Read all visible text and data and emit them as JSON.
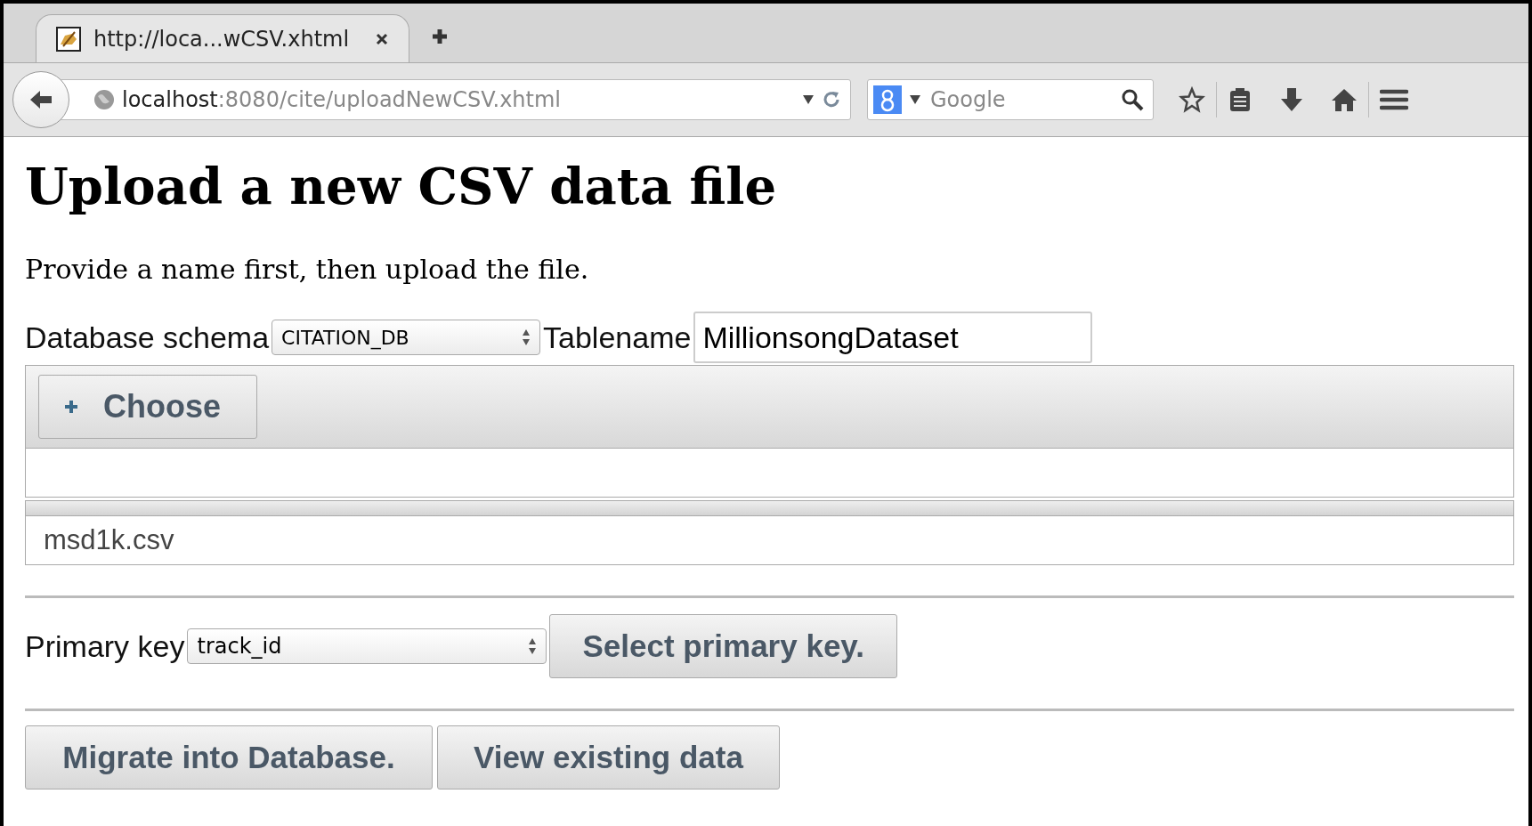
{
  "browser": {
    "tabs": [
      {
        "title": "http://loca...wCSV.xhtml",
        "selected": true
      }
    ],
    "address": {
      "host": "localhost",
      "path": ":8080/cite/uploadNewCSV.xhtml"
    },
    "search": {
      "placeholder": "Google"
    }
  },
  "page": {
    "heading": "Upload a new CSV data file",
    "intro": "Provide a name first, then upload the file.",
    "schema": {
      "label": "Database schema",
      "value": "CITATION_DB"
    },
    "tablename": {
      "label": "Tablename",
      "value": "MillionsongDataset"
    },
    "upload": {
      "choose_label": "Choose",
      "progress": {
        "level": 0
      },
      "files": [
        "msd1k.csv"
      ]
    },
    "primary_key": {
      "label": "Primary key",
      "value": "track_id",
      "button": "Select primary key."
    },
    "buttons": [
      "Migrate into Database.",
      "View existing data"
    ]
  }
}
